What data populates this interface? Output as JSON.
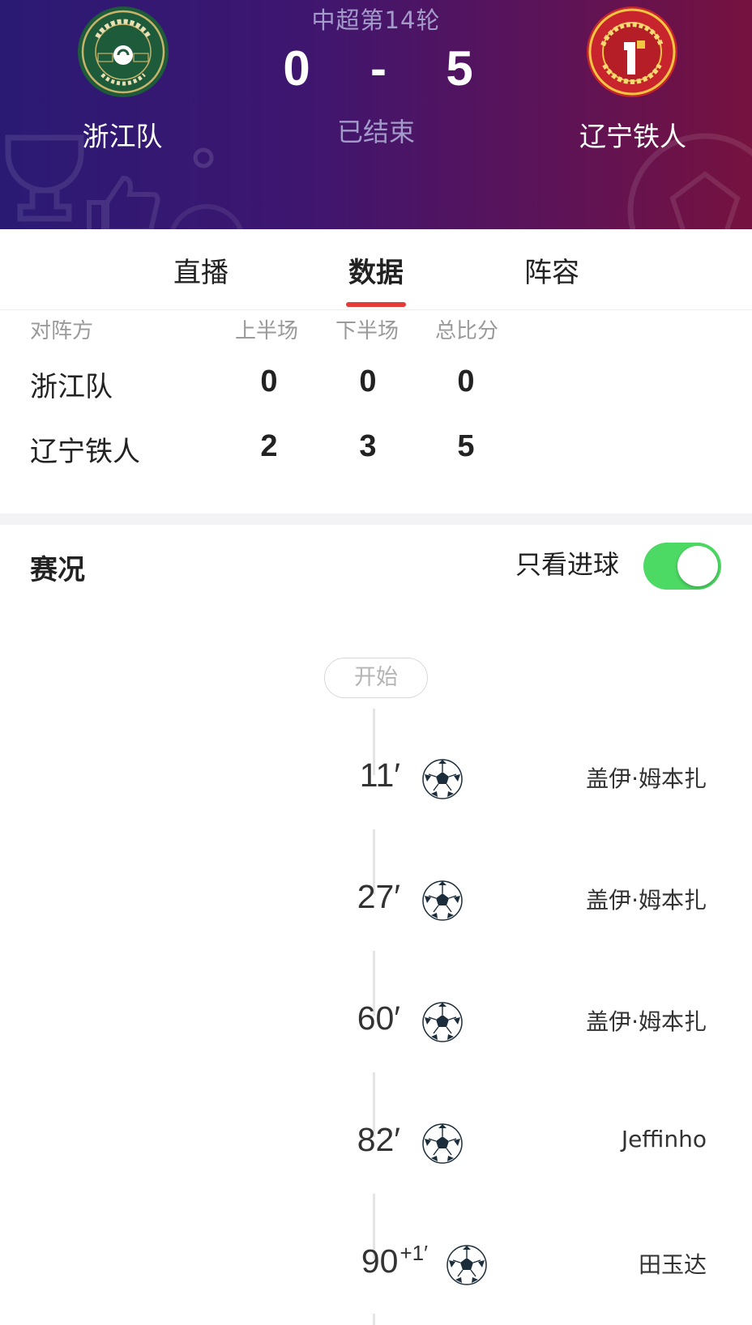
{
  "header": {
    "round": "中超第14轮",
    "home_team": "浙江队",
    "away_team": "辽宁铁人",
    "home_score": "0",
    "score_separator": "-",
    "away_score": "5",
    "status": "已结束",
    "home_logo_text": "GREENTOWN FC ZHEJIANG 1998",
    "away_logo_text": "LIAONING TIEREN FOOTBALL CLUB"
  },
  "tabs": [
    {
      "label": "直播"
    },
    {
      "label": "数据",
      "active": true
    },
    {
      "label": "阵容"
    }
  ],
  "score_table": {
    "headers": {
      "team": "对阵方",
      "first_half": "上半场",
      "second_half": "下半场",
      "total": "总比分"
    },
    "rows": [
      {
        "team": "浙江队",
        "first_half": "0",
        "second_half": "0",
        "total": "0"
      },
      {
        "team": "辽宁铁人",
        "first_half": "2",
        "second_half": "3",
        "total": "5"
      }
    ]
  },
  "events": {
    "title": "赛况",
    "goals_only_label": "只看进球",
    "goals_only_enabled": true,
    "start_label": "开始",
    "items": [
      {
        "minute": "11′",
        "extra": "",
        "icon": "soccer-ball-icon",
        "player": "盖伊·姆本扎"
      },
      {
        "minute": "27′",
        "extra": "",
        "icon": "soccer-ball-icon",
        "player": "盖伊·姆本扎"
      },
      {
        "minute": "60′",
        "extra": "",
        "icon": "soccer-ball-icon",
        "player": "盖伊·姆本扎"
      },
      {
        "minute": "82′",
        "extra": "",
        "icon": "soccer-ball-icon",
        "player": "Jeffinho"
      },
      {
        "minute": "90",
        "extra": "+1′",
        "icon": "soccer-ball-icon",
        "player": "田玉达"
      }
    ]
  },
  "colors": {
    "header_gradient_start": "#2a1a74",
    "header_gradient_end": "#76123f",
    "tab_underline": "#e63b3b",
    "toggle_on": "#4cd964",
    "home_logo_green": "#1e5b3a",
    "away_logo_red": "#c8242d"
  }
}
